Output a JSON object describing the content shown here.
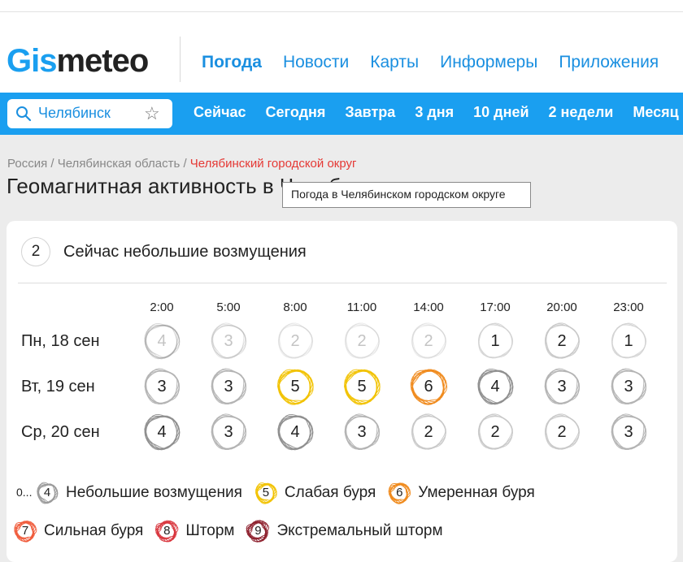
{
  "header": {
    "logo_part1": "Gis",
    "logo_part2": "meteo",
    "nav": [
      "Погода",
      "Новости",
      "Карты",
      "Информеры",
      "Приложения"
    ]
  },
  "search": {
    "city": "Челябинск"
  },
  "day_nav": [
    "Сейчас",
    "Сегодня",
    "Завтра",
    "3 дня",
    "10 дней",
    "2 недели",
    "Месяц"
  ],
  "breadcrumbs": {
    "item1": "Россия",
    "sep": "/",
    "item2": "Челябинская область",
    "current": "Челябинский городской округ"
  },
  "page_title": "Геомагнитная активность в Челябинске",
  "tooltip": "Погода в Челябинском городском округе",
  "now": {
    "value": "2",
    "text": "Сейчас небольшие возмущения"
  },
  "times": [
    "2:00",
    "5:00",
    "8:00",
    "11:00",
    "14:00",
    "17:00",
    "20:00",
    "23:00"
  ],
  "days": [
    {
      "label": "Пн, 18 сен",
      "values": [
        4,
        3,
        2,
        2,
        2,
        1,
        2,
        1
      ],
      "past_count": 5
    },
    {
      "label": "Вт, 19 сен",
      "values": [
        3,
        3,
        5,
        5,
        6,
        4,
        3,
        3
      ],
      "past_count": 0
    },
    {
      "label": "Ср, 20 сен",
      "values": [
        4,
        3,
        4,
        3,
        2,
        2,
        2,
        3
      ],
      "past_count": 0
    }
  ],
  "legend": {
    "zero_prefix": "0...",
    "items": [
      {
        "value": "4",
        "label": "Небольшие возмущения",
        "color": "#9a9a9a"
      },
      {
        "value": "5",
        "label": "Слабая буря",
        "color": "#f2c200"
      },
      {
        "value": "6",
        "label": "Умеренная буря",
        "color": "#f08a1c"
      },
      {
        "value": "7",
        "label": "Сильная буря",
        "color": "#ef5a3a"
      },
      {
        "value": "8",
        "label": "Шторм",
        "color": "#d8343c"
      },
      {
        "value": "9",
        "label": "Экстремальный шторм",
        "color": "#8c1d2a"
      }
    ]
  },
  "level_colors": {
    "1": "#d2d2d2",
    "2": "#c8c8c8",
    "3": "#b2b2b2",
    "4": "#8e8e8e",
    "5": "#f2c200",
    "6": "#f08a1c",
    "7": "#ef5a3a",
    "8": "#d8343c",
    "9": "#8c1d2a"
  }
}
